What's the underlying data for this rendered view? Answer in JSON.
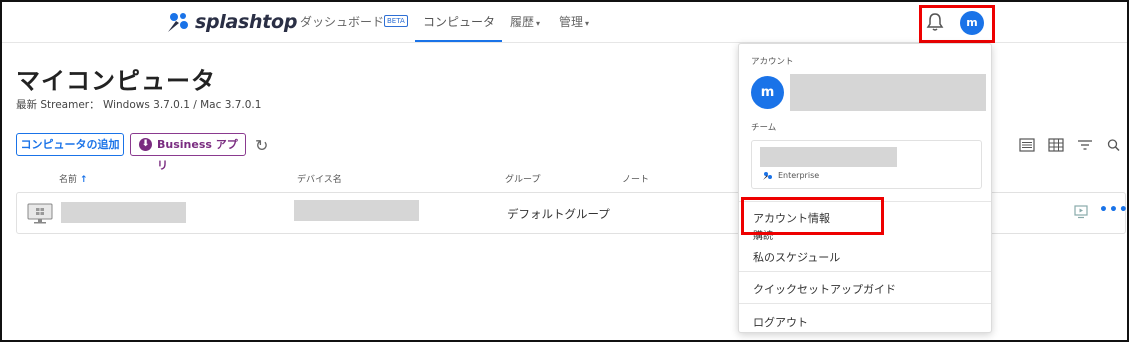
{
  "nav": {
    "logo_text": "splashtop",
    "dashboard": "ダッシュボード",
    "beta": "BETA",
    "computers": "コンピュータ",
    "history": "履歴",
    "admin": "管理",
    "caret": "▾",
    "avatar_initial": "m"
  },
  "page": {
    "title": "マイコンピュータ",
    "streamer": "最新 Streamer： Windows 3.7.0.1 / Mac 3.7.0.1",
    "add_button": "コンピュータの追加",
    "business_button": "Business アプリ",
    "business_icon": "⬇",
    "refresh_icon": "↻"
  },
  "table": {
    "headers": {
      "name": "名前",
      "sort_arrow": "↑",
      "device": "デバイス名",
      "group": "グループ",
      "note": "ノート"
    },
    "rows": [
      {
        "group": "デフォルトグループ"
      }
    ],
    "more_icon": "•••"
  },
  "dropdown": {
    "account_label": "アカウント",
    "avatar_initial": "m",
    "team_label": "チーム",
    "team_plan": "Enterprise",
    "items": [
      "アカウント情報",
      "購読",
      "私のスケジュール",
      "クイックセットアップガイド",
      "ログアウト"
    ]
  },
  "colors": {
    "accent": "#1a73e8",
    "business": "#7a2c80",
    "highlight": "#e00000"
  }
}
